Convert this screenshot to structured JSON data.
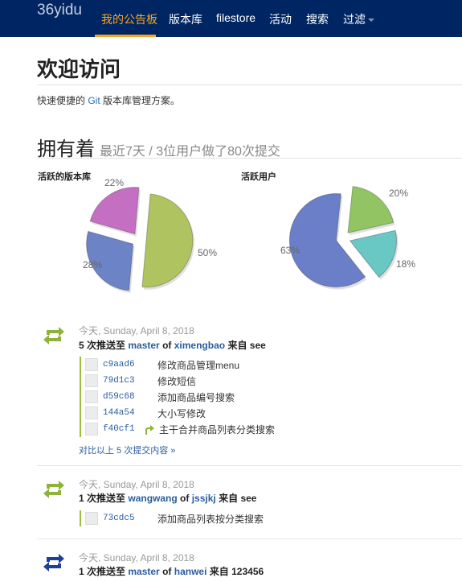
{
  "nav": {
    "brand": "36yidu",
    "items": [
      "我的公告板",
      "版本库",
      "filestore",
      "活动",
      "搜索",
      "过滤"
    ]
  },
  "welcome": {
    "title": "欢迎访问",
    "intro_pre": "快速便捷的 ",
    "intro_link": "Git",
    "intro_post": " 版本库管理方案。"
  },
  "owns": {
    "title": "拥有着",
    "subtitle": "最近7天 / 3位用户做了80次提交"
  },
  "chart_data": [
    {
      "type": "pie",
      "title": "活跃的版本库",
      "slices": [
        {
          "label": "50%",
          "value": 50,
          "color": "#afc361"
        },
        {
          "label": "28%",
          "value": 28,
          "color": "#6c83c6"
        },
        {
          "label": "22%",
          "value": 22,
          "color": "#c46fc2"
        }
      ]
    },
    {
      "type": "pie",
      "title": "活跃用户",
      "slices": [
        {
          "label": "20%",
          "value": 20,
          "color": "#92c463"
        },
        {
          "label": "18%",
          "value": 18,
          "color": "#69c7c4"
        },
        {
          "label": "63%",
          "value": 63,
          "color": "#6a7fc8"
        }
      ]
    }
  ],
  "feed": [
    {
      "icon": "push-icon-green",
      "date": "今天, Sunday, April 8, 2018",
      "headline": {
        "count": "5 次推送至",
        "branch": "master",
        "of": "of",
        "repo": "ximengbao",
        "from": "来自",
        "user": "see"
      },
      "commits": [
        {
          "sha": "c9aad6",
          "msg": "修改商品管理menu",
          "merge": false
        },
        {
          "sha": "79d1c3",
          "msg": "修改短信",
          "merge": false
        },
        {
          "sha": "d59c68",
          "msg": "添加商品编号搜索",
          "merge": false
        },
        {
          "sha": "144a54",
          "msg": "大小写修改",
          "merge": false
        },
        {
          "sha": "f40cf1",
          "msg": "主干合并商品列表分类搜索",
          "merge": true
        }
      ],
      "more": "对比以上 5 次提交内容 »"
    },
    {
      "icon": "push-icon-green",
      "date": "今天, Sunday, April 8, 2018",
      "headline": {
        "count": "1 次推送至",
        "branch": "wangwang",
        "of": "of",
        "repo": "jssjkj",
        "from": "来自",
        "user": "see"
      },
      "commits": [
        {
          "sha": "73cdc5",
          "msg": "添加商品列表按分类搜索",
          "merge": false
        }
      ],
      "more": ""
    },
    {
      "icon": "push-icon-blue",
      "date": "今天, Sunday, April 8, 2018",
      "headline": {
        "count": "1 次推送至",
        "branch": "master",
        "of": "of",
        "repo": "hanwei",
        "from": "来自",
        "user": "123456"
      },
      "commits": [],
      "more": ""
    }
  ]
}
